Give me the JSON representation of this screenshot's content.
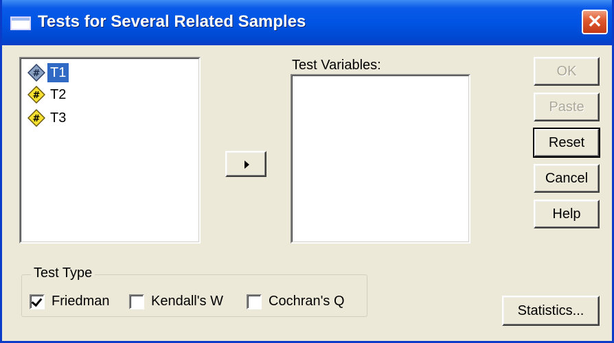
{
  "window": {
    "title": "Tests for Several Related Samples"
  },
  "source_list": {
    "items": [
      {
        "label": "T1",
        "selected": true,
        "icon": "scale-variable-icon"
      },
      {
        "label": "T2",
        "selected": false,
        "icon": "numeric-variable-icon"
      },
      {
        "label": "T3",
        "selected": false,
        "icon": "numeric-variable-icon"
      }
    ]
  },
  "target_list": {
    "label": "Test Variables:"
  },
  "buttons": {
    "ok": "OK",
    "paste": "Paste",
    "reset": "Reset",
    "cancel": "Cancel",
    "help": "Help",
    "statistics": "Statistics..."
  },
  "test_type": {
    "title": "Test Type",
    "options": [
      {
        "label": "Friedman",
        "checked": true
      },
      {
        "label": "Kendall's W",
        "checked": false
      },
      {
        "label": "Cochran's Q",
        "checked": false
      }
    ]
  }
}
